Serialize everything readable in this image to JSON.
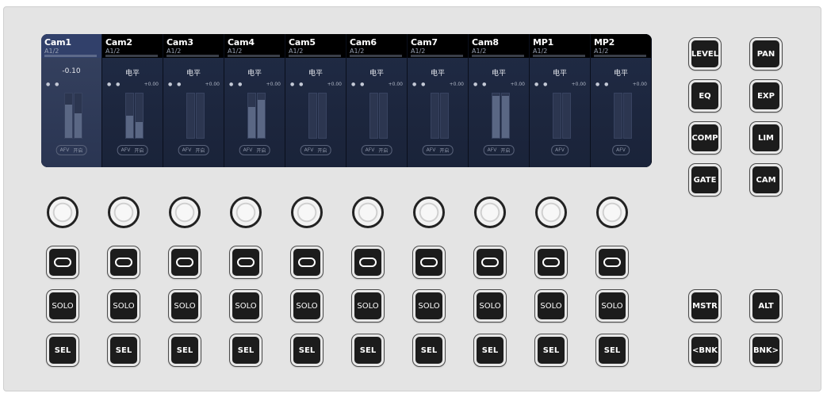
{
  "screen": {
    "active_value": "-0.10",
    "level_label": "电平",
    "db_label": "+0.00",
    "dots": "● ●",
    "afv_label": "AFV",
    "on_label": "开启",
    "channels": [
      {
        "name": "Cam1",
        "sub": "A1/2",
        "active": true,
        "fill_left": 0.75,
        "fill_right": 0.55,
        "has_on": true
      },
      {
        "name": "Cam2",
        "sub": "A1/2",
        "active": false,
        "fill_left": 0.5,
        "fill_right": 0.35,
        "has_on": true
      },
      {
        "name": "Cam3",
        "sub": "A1/2",
        "active": false,
        "fill_left": 0,
        "fill_right": 0,
        "has_on": true
      },
      {
        "name": "Cam4",
        "sub": "A1/2",
        "active": false,
        "fill_left": 0.7,
        "fill_right": 0.85,
        "has_on": true
      },
      {
        "name": "Cam5",
        "sub": "A1/2",
        "active": false,
        "fill_left": 0,
        "fill_right": 0,
        "has_on": true
      },
      {
        "name": "Cam6",
        "sub": "A1/2",
        "active": false,
        "fill_left": 0,
        "fill_right": 0,
        "has_on": true
      },
      {
        "name": "Cam7",
        "sub": "A1/2",
        "active": false,
        "fill_left": 0,
        "fill_right": 0,
        "has_on": true
      },
      {
        "name": "Cam8",
        "sub": "A1/2",
        "active": false,
        "fill_left": 0.95,
        "fill_right": 0.95,
        "has_on": true
      },
      {
        "name": "MP1",
        "sub": "A1/2",
        "active": false,
        "fill_left": 0,
        "fill_right": 0,
        "has_on": false
      },
      {
        "name": "MP2",
        "sub": "A1/2",
        "active": false,
        "fill_left": 0,
        "fill_right": 0,
        "has_on": false
      }
    ]
  },
  "strip": {
    "solo_label": "SOLO",
    "sel_label": "SEL"
  },
  "right_buttons": {
    "top": [
      "LEVEL",
      "PAN",
      "EQ",
      "EXP",
      "COMP",
      "LIM",
      "GATE",
      "CAM"
    ],
    "bottom": [
      "MSTR",
      "ALT",
      "<BNK",
      "BNK>"
    ]
  },
  "colors": {
    "screen_bg": "#121a2d",
    "button_bg": "#1c1c1c",
    "panel_bg": "#e4e4e4"
  }
}
